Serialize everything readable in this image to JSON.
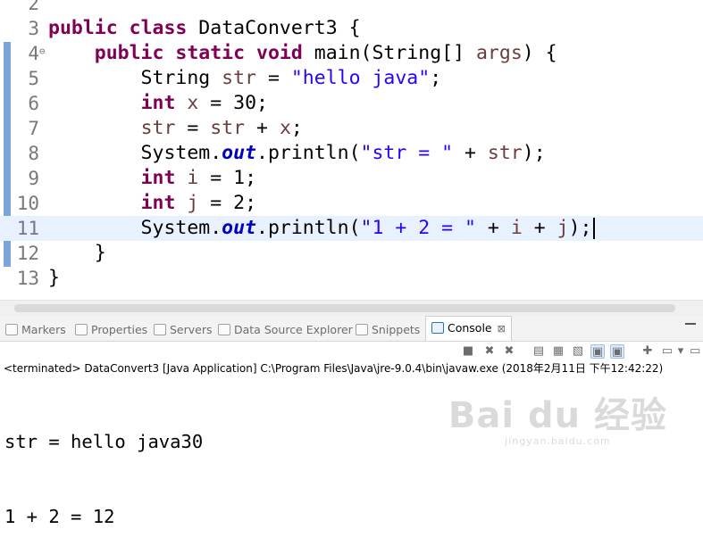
{
  "editor": {
    "lines": [
      {
        "num": "2",
        "tokens": []
      },
      {
        "num": "3",
        "tokens": [
          {
            "t": "kw",
            "v": "public"
          },
          {
            "t": "p",
            "v": " "
          },
          {
            "t": "kw",
            "v": "class"
          },
          {
            "t": "p",
            "v": " DataConvert3 {"
          }
        ]
      },
      {
        "num": "4",
        "fold": "⊖",
        "tokens": [
          {
            "t": "p",
            "v": "    "
          },
          {
            "t": "kw",
            "v": "public"
          },
          {
            "t": "p",
            "v": " "
          },
          {
            "t": "kw",
            "v": "static"
          },
          {
            "t": "p",
            "v": " "
          },
          {
            "t": "kw",
            "v": "void"
          },
          {
            "t": "p",
            "v": " main(String[] "
          },
          {
            "t": "var",
            "v": "args"
          },
          {
            "t": "p",
            "v": ") {"
          }
        ]
      },
      {
        "num": "5",
        "tokens": [
          {
            "t": "p",
            "v": "        String "
          },
          {
            "t": "var",
            "v": "str"
          },
          {
            "t": "p",
            "v": " = "
          },
          {
            "t": "str",
            "v": "\"hello java\""
          },
          {
            "t": "p",
            "v": ";"
          }
        ]
      },
      {
        "num": "6",
        "tokens": [
          {
            "t": "p",
            "v": "        "
          },
          {
            "t": "kw",
            "v": "int"
          },
          {
            "t": "p",
            "v": " "
          },
          {
            "t": "var",
            "v": "x"
          },
          {
            "t": "p",
            "v": " = 30;"
          }
        ]
      },
      {
        "num": "7",
        "tokens": [
          {
            "t": "p",
            "v": "        "
          },
          {
            "t": "var",
            "v": "str"
          },
          {
            "t": "p",
            "v": " = "
          },
          {
            "t": "var",
            "v": "str"
          },
          {
            "t": "p",
            "v": " + "
          },
          {
            "t": "var",
            "v": "x"
          },
          {
            "t": "p",
            "v": ";"
          }
        ]
      },
      {
        "num": "8",
        "tokens": [
          {
            "t": "p",
            "v": "        System."
          },
          {
            "t": "fld",
            "v": "out"
          },
          {
            "t": "p",
            "v": ".println("
          },
          {
            "t": "str",
            "v": "\"str = \""
          },
          {
            "t": "p",
            "v": " + "
          },
          {
            "t": "var",
            "v": "str"
          },
          {
            "t": "p",
            "v": ");"
          }
        ]
      },
      {
        "num": "9",
        "tokens": [
          {
            "t": "p",
            "v": "        "
          },
          {
            "t": "kw",
            "v": "int"
          },
          {
            "t": "p",
            "v": " "
          },
          {
            "t": "var",
            "v": "i"
          },
          {
            "t": "p",
            "v": " = 1;"
          }
        ]
      },
      {
        "num": "10",
        "tokens": [
          {
            "t": "p",
            "v": "        "
          },
          {
            "t": "kw",
            "v": "int"
          },
          {
            "t": "p",
            "v": " "
          },
          {
            "t": "var",
            "v": "j"
          },
          {
            "t": "p",
            "v": " = 2;"
          }
        ]
      },
      {
        "num": "11",
        "current": true,
        "tokens": [
          {
            "t": "p",
            "v": "        System."
          },
          {
            "t": "fld",
            "v": "out"
          },
          {
            "t": "p",
            "v": ".println("
          },
          {
            "t": "str",
            "v": "\"1 + 2 = \""
          },
          {
            "t": "p",
            "v": " + "
          },
          {
            "t": "var",
            "v": "i"
          },
          {
            "t": "p",
            "v": " + "
          },
          {
            "t": "var",
            "v": "j"
          },
          {
            "t": "p",
            "v": ");"
          }
        ]
      },
      {
        "num": "12",
        "tokens": [
          {
            "t": "p",
            "v": "    }"
          }
        ]
      },
      {
        "num": "13",
        "tokens": [
          {
            "t": "p",
            "v": "}"
          }
        ]
      }
    ]
  },
  "tabs": [
    {
      "label": "Markers",
      "icon": "markers-icon"
    },
    {
      "label": "Properties",
      "icon": "properties-icon"
    },
    {
      "label": "Servers",
      "icon": "servers-icon"
    },
    {
      "label": "Data Source Explorer",
      "icon": "data-source-icon"
    },
    {
      "label": "Snippets",
      "icon": "snippets-icon"
    },
    {
      "label": "Console",
      "icon": "console-icon",
      "active": true,
      "close": "⊠"
    }
  ],
  "console": {
    "status": "<terminated> DataConvert3 [Java Application] C:\\Program Files\\Java\\jre-9.0.4\\bin\\javaw.exe (2018年2月11日 下午12:42:22)",
    "output": [
      "str = hello java30",
      "1 + 2 = 12"
    ]
  },
  "watermark": {
    "logo": "Bai du 经验",
    "sub": "jingyan.baidu.com"
  }
}
